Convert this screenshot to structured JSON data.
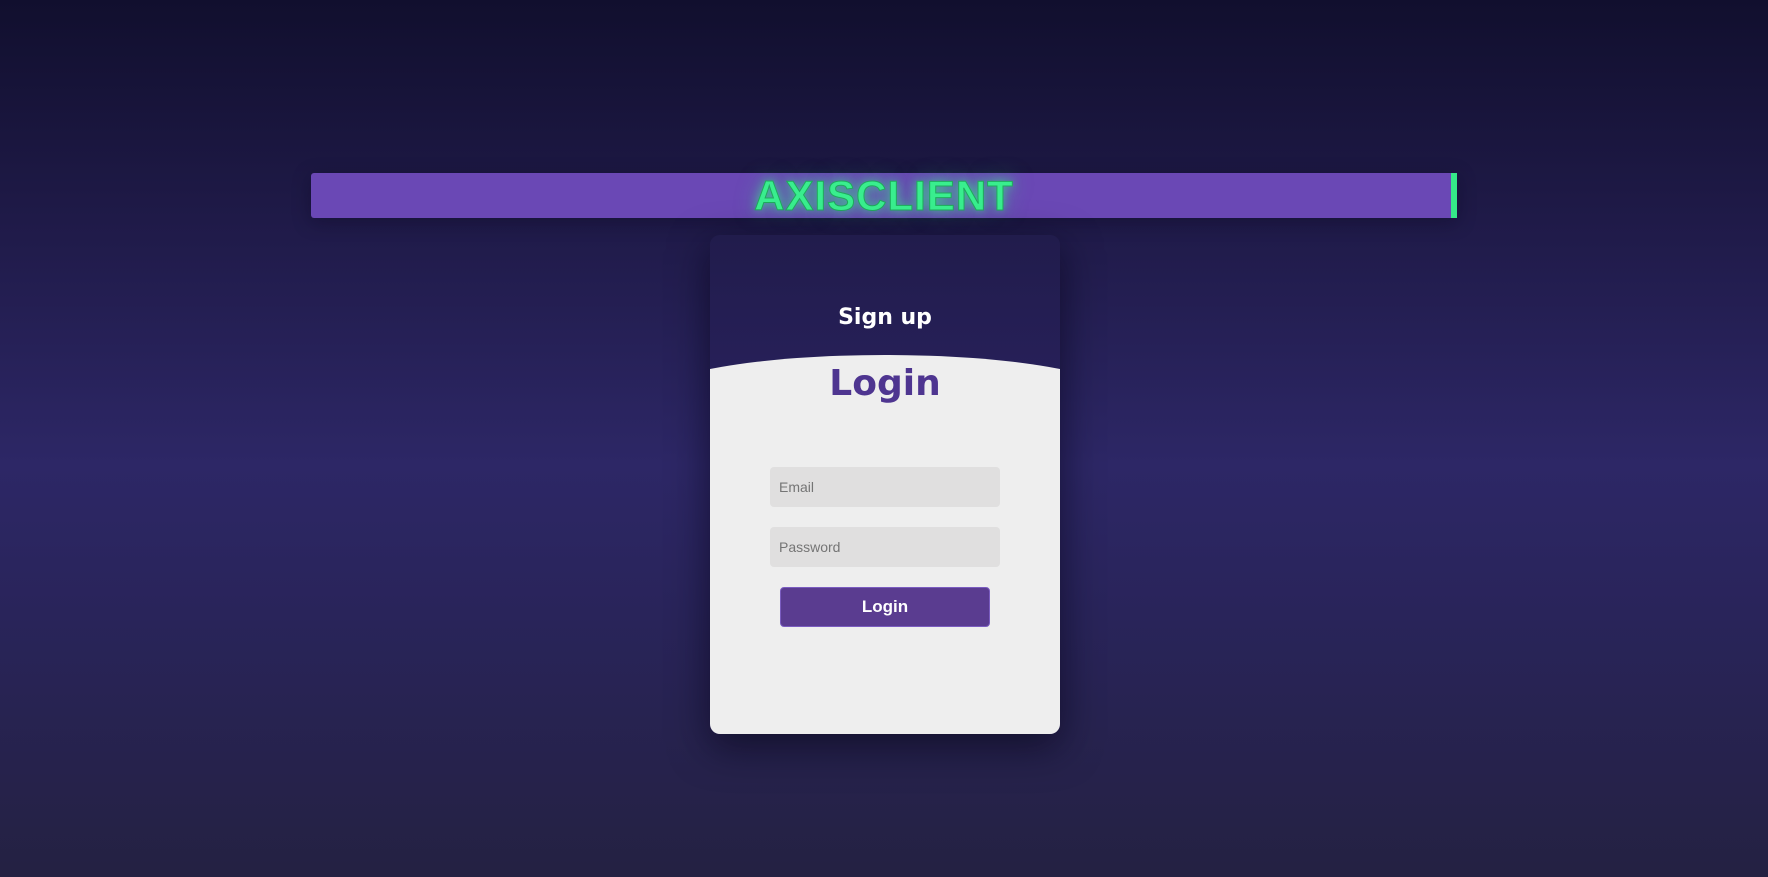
{
  "brand": {
    "title": "AXISCLIENT"
  },
  "auth": {
    "signup_label": "Sign up",
    "login_heading": "Login",
    "email_placeholder": "Email",
    "password_placeholder": "Password",
    "login_button": "Login"
  },
  "colors": {
    "accent_green": "#39ee8e",
    "bar_purple": "#6a48b5",
    "button_purple": "#5a3c90",
    "heading_purple": "#4e3590"
  }
}
